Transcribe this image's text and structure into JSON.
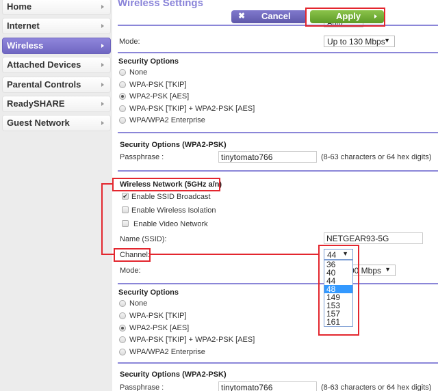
{
  "sidebar": {
    "items": [
      {
        "label": "Home",
        "active": false
      },
      {
        "label": "Internet",
        "active": false
      },
      {
        "label": "Wireless",
        "active": true
      },
      {
        "label": "Attached Devices",
        "active": false
      },
      {
        "label": "Parental Controls",
        "active": false
      },
      {
        "label": "ReadySHARE",
        "active": false
      },
      {
        "label": "Guest Network",
        "active": false
      }
    ]
  },
  "header": {
    "title": "Wireless Settings",
    "cancel_label": "Cancel",
    "cancel_icon": "x-icon",
    "cancel_glyph": "✖",
    "apply_label": "Apply"
  },
  "top_partial": {
    "channel_value": "Auto",
    "mode_label": "Mode:",
    "mode_value": "Up to 130 Mbps"
  },
  "security_24": {
    "heading": "Security Options",
    "options": [
      "None",
      "WPA-PSK [TKIP]",
      "WPA2-PSK [AES]",
      "WPA-PSK [TKIP] + WPA2-PSK [AES]",
      "WPA/WPA2 Enterprise"
    ],
    "selected": "WPA2-PSK [AES]"
  },
  "wpa2_24": {
    "heading": "Security Options (WPA2-PSK)",
    "passphrase_label": "Passphrase :",
    "passphrase_value": "tinytomato766",
    "hint": "(8-63 characters or 64 hex digits)"
  },
  "wireless_5g": {
    "heading": "Wireless Network (5GHz a/n)",
    "checkboxes": [
      {
        "label": "Enable SSID Broadcast",
        "checked": true
      },
      {
        "label": "Enable Wireless Isolation",
        "checked": false
      },
      {
        "label": "Enable Video Network",
        "checked": false
      }
    ],
    "ssid_label": "Name (SSID):",
    "ssid_value": "NETGEAR93-5G",
    "channel_label": "Channel:",
    "channel_value": "44",
    "channel_options": [
      "36",
      "40",
      "44",
      "48",
      "149",
      "153",
      "157",
      "161"
    ],
    "channel_highlighted": "48",
    "mode_label": "Mode:",
    "mode_value_visible": "00 Mbps"
  },
  "security_5g": {
    "heading": "Security Options",
    "options": [
      "None",
      "WPA-PSK [TKIP]",
      "WPA2-PSK [AES]",
      "WPA-PSK [TKIP] + WPA2-PSK [AES]",
      "WPA/WPA2 Enterprise"
    ],
    "selected": "WPA2-PSK [AES]"
  },
  "wpa2_5g": {
    "heading": "Security Options (WPA2-PSK)",
    "passphrase_label": "Passphrase :",
    "passphrase_value": "tinytomato766",
    "hint": "(8-63 characters or 64 hex digits)"
  },
  "colors": {
    "accent": "#8a84d9",
    "active_nav": "#7a71cf",
    "apply_green": "#6fae33",
    "highlight_red": "#e3262e",
    "dropdown_highlight": "#3399ff"
  }
}
